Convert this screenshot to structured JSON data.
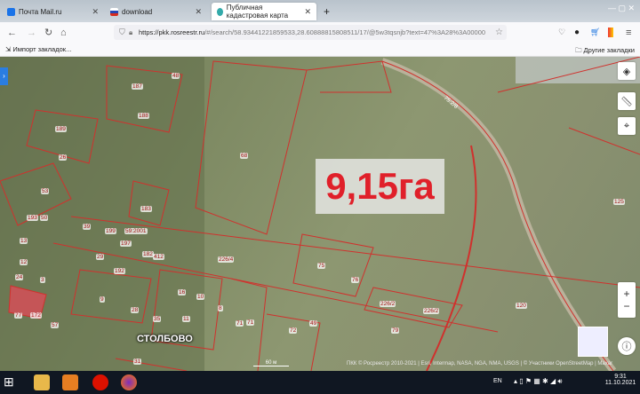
{
  "browser": {
    "tabs": [
      {
        "label": "Почта Mail.ru",
        "color": "#1a73e8"
      },
      {
        "label": "download",
        "color": "#d52b1e"
      },
      {
        "label": "Публичная кадастровая карта",
        "active": true,
        "color": "#3aa"
      }
    ],
    "new_tab": "+",
    "url_host": "https://pkk.rosreestr.ru",
    "url_rest": "/#/search/58.93441221859533,28.60888815808511/17/@5w3tqsnjb?text=47%3A28%3A00000",
    "bookmarks": {
      "import": "Импорт закладок...",
      "other": "Другие закладки"
    }
  },
  "map": {
    "area_label": "9,15га",
    "village": "СТОЛБОВО",
    "road_label": "75:2/8",
    "scale": "60 м",
    "attribution": "ПКК © Росреестр 2010-2021 | Esri, Intermap, NASA, NGA, NMA, USGS | © Участники OpenStreetMap | Maxar",
    "parcels": [
      "187",
      "48",
      "188",
      "189",
      "26",
      "68",
      "183",
      "53",
      "193",
      "50",
      "13",
      "39",
      "199",
      "59:2001",
      "197",
      "182",
      "412",
      "226/4",
      "12",
      "24",
      "3",
      "192",
      "29",
      "9",
      "28",
      "16",
      "10",
      "77",
      "172",
      "57",
      "35",
      "11",
      "8",
      "71",
      "75",
      "76",
      "226/2",
      "226/2",
      "125",
      "120",
      "72",
      "49",
      "79",
      "71",
      "31"
    ],
    "accent": "#e0202a"
  },
  "taskbar": {
    "lang": "EN",
    "time": "9:31",
    "date": "11.10.2021"
  }
}
